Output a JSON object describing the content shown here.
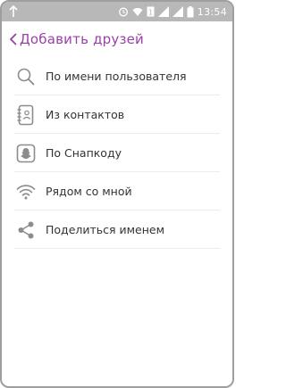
{
  "status_bar": {
    "time": "13:54"
  },
  "header": {
    "back_icon": "chevron-left-icon",
    "title": "Добавить друзей"
  },
  "menu": {
    "items": [
      {
        "icon": "search-icon",
        "label": "По имени пользователя"
      },
      {
        "icon": "contacts-book-icon",
        "label": "Из контактов"
      },
      {
        "icon": "snapcode-ghost-icon",
        "label": "По Снапкоду"
      },
      {
        "icon": "wifi-nearby-icon",
        "label": "Рядом со мной"
      },
      {
        "icon": "share-icon",
        "label": "Поделиться именем"
      }
    ]
  },
  "colors": {
    "accent": "#9b3fa9",
    "icon": "#8c8c8c",
    "text": "#333333",
    "status_bar": "#b8b8b8"
  }
}
